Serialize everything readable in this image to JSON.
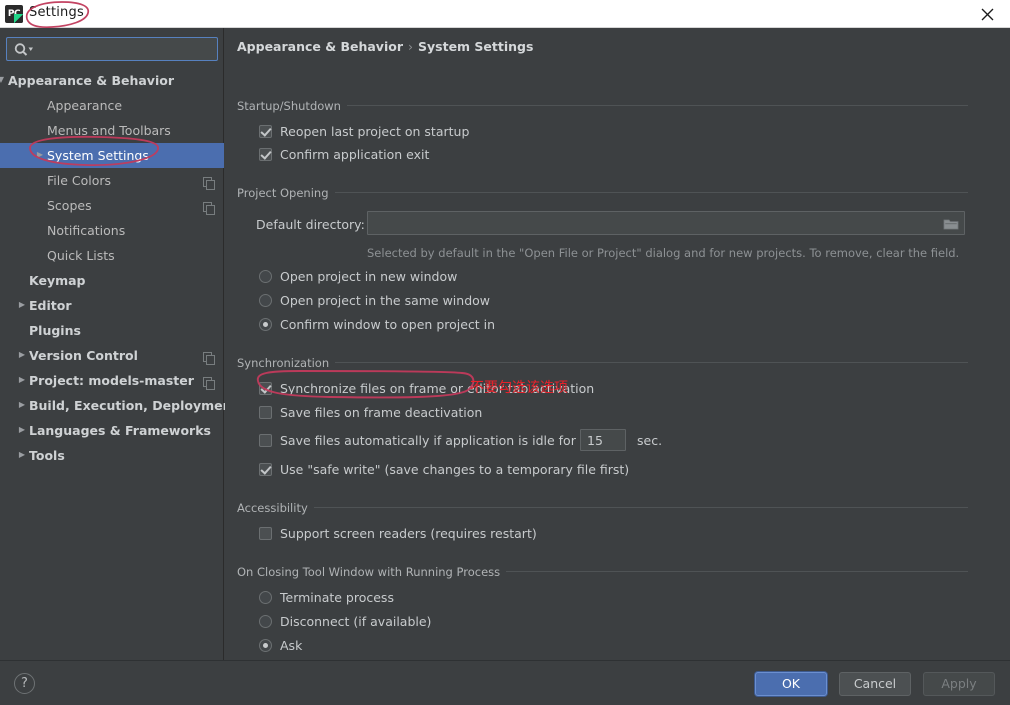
{
  "window": {
    "title": "Settings",
    "app_icon": "pycharm-icon",
    "close_icon": "close-icon"
  },
  "sidebar": {
    "search": {
      "value": "",
      "placeholder": "",
      "icon": "search-icon"
    },
    "items": [
      {
        "label": "Appearance & Behavior",
        "indent": 8,
        "arrow": "down",
        "bold": true,
        "selected": false,
        "copy": false
      },
      {
        "label": "Appearance",
        "indent": 47,
        "arrow": "none",
        "bold": false,
        "selected": false,
        "copy": false
      },
      {
        "label": "Menus and Toolbars",
        "indent": 47,
        "arrow": "none",
        "bold": false,
        "selected": false,
        "copy": false
      },
      {
        "label": "System Settings",
        "indent": 47,
        "arrow": "right",
        "bold": false,
        "selected": true,
        "copy": false
      },
      {
        "label": "File Colors",
        "indent": 47,
        "arrow": "none",
        "bold": false,
        "selected": false,
        "copy": true
      },
      {
        "label": "Scopes",
        "indent": 47,
        "arrow": "none",
        "bold": false,
        "selected": false,
        "copy": true
      },
      {
        "label": "Notifications",
        "indent": 47,
        "arrow": "none",
        "bold": false,
        "selected": false,
        "copy": false
      },
      {
        "label": "Quick Lists",
        "indent": 47,
        "arrow": "none",
        "bold": false,
        "selected": false,
        "copy": false
      },
      {
        "label": "Keymap",
        "indent": 29,
        "arrow": "none",
        "bold": true,
        "selected": false,
        "copy": false
      },
      {
        "label": "Editor",
        "indent": 29,
        "arrow": "right",
        "bold": true,
        "selected": false,
        "copy": false
      },
      {
        "label": "Plugins",
        "indent": 29,
        "arrow": "none",
        "bold": true,
        "selected": false,
        "copy": false
      },
      {
        "label": "Version Control",
        "indent": 29,
        "arrow": "right",
        "bold": true,
        "selected": false,
        "copy": true
      },
      {
        "label": "Project: models-master",
        "indent": 29,
        "arrow": "right",
        "bold": true,
        "selected": false,
        "copy": true
      },
      {
        "label": "Build, Execution, Deployment",
        "indent": 29,
        "arrow": "right",
        "bold": true,
        "selected": false,
        "copy": false
      },
      {
        "label": "Languages & Frameworks",
        "indent": 29,
        "arrow": "right",
        "bold": true,
        "selected": false,
        "copy": false
      },
      {
        "label": "Tools",
        "indent": 29,
        "arrow": "right",
        "bold": true,
        "selected": false,
        "copy": false
      }
    ]
  },
  "breadcrumb": {
    "parent": "Appearance & Behavior",
    "separator": "›",
    "current": "System Settings"
  },
  "sections": {
    "startup": {
      "title": "Startup/Shutdown",
      "reopen_label": "Reopen last project on startup",
      "reopen_checked": true,
      "confirm_exit_label": "Confirm application exit",
      "confirm_exit_checked": true
    },
    "project_opening": {
      "title": "Project Opening",
      "dir_label": "Default directory:",
      "dir_value": "",
      "dir_browse_icon": "folder-icon",
      "hint": "Selected by default in the \"Open File or Project\" dialog and for new projects. To remove, clear the field.",
      "radio_new_window": "Open project in new window",
      "radio_same_window": "Open project in the same window",
      "radio_confirm": "Confirm window to open project in",
      "selected_radio": "confirm"
    },
    "synchronization": {
      "title": "Synchronization",
      "sync_on_activation_label": "Synchronize files on frame or editor tab activation",
      "sync_on_activation_checked": true,
      "save_on_deactivation_label": "Save files on frame deactivation",
      "save_on_deactivation_checked": false,
      "save_idle_label": "Save files automatically if application is idle for",
      "save_idle_checked": false,
      "idle_seconds": "15",
      "idle_unit": "sec.",
      "safe_write_label": "Use \"safe write\" (save changes to a temporary file first)",
      "safe_write_checked": true
    },
    "accessibility": {
      "title": "Accessibility",
      "screen_readers_label": "Support screen readers (requires restart)",
      "screen_readers_checked": false
    },
    "closing_tool_window": {
      "title": "On Closing Tool Window with Running Process",
      "radio_terminate": "Terminate process",
      "radio_disconnect": "Disconnect (if available)",
      "radio_ask": "Ask",
      "selected_radio": "ask"
    }
  },
  "footer": {
    "help_label": "?",
    "ok_label": "OK",
    "cancel_label": "Cancel",
    "apply_label": "Apply",
    "apply_enabled": false
  },
  "annotations": {
    "color": "#e8212a",
    "note_text": "不要勾选该选项",
    "circles": [
      "title-settings-circle",
      "sidebar-system-settings-circle",
      "save-on-deactivation-circle"
    ]
  }
}
